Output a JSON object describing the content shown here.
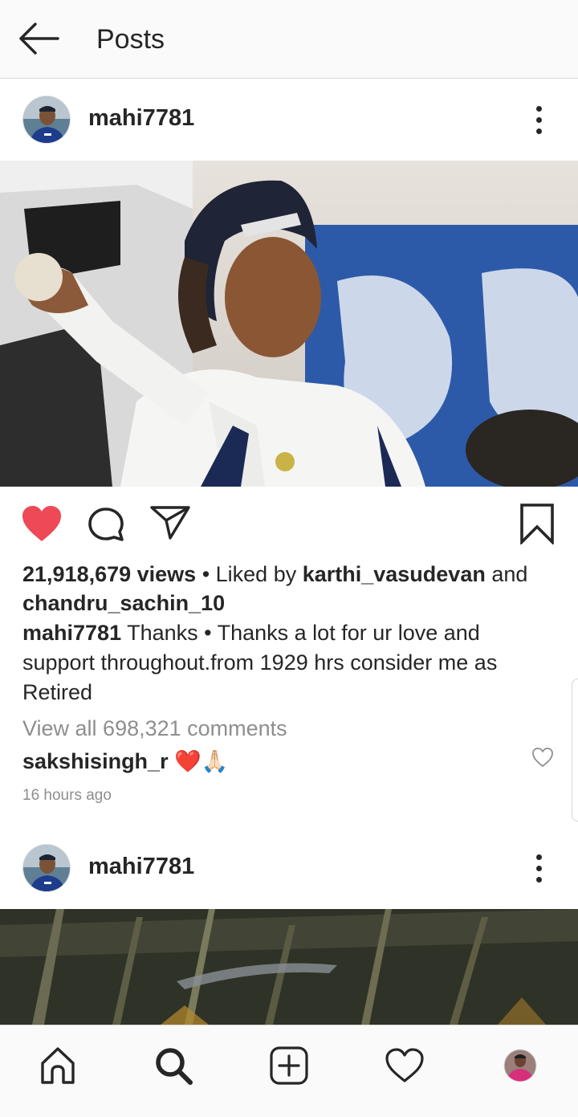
{
  "topbar": {
    "title": "Posts",
    "back_icon": "arrow-left-icon"
  },
  "post1": {
    "username": "mahi7781",
    "views": "21,918,679 views",
    "liked_by_prefix": " • Liked by ",
    "liked_by_user1": "karthi_vasudevan",
    "liked_by_and": " and",
    "liked_by_user2": "chandru_sachin_10",
    "caption_user": "mahi7781",
    "caption_text": " Thanks • Thanks a lot for ur love and support throughout.from 1929 hrs consider me as Retired",
    "view_comments": "View all 698,321 comments",
    "comment_user": "sakshisingh_r",
    "comment_emoji": "❤️🙏🏻",
    "timestamp": "16 hours ago",
    "liked": true
  },
  "post2": {
    "username": "mahi7781"
  },
  "nav": {
    "items": [
      "home-icon",
      "search-icon",
      "add-icon",
      "heart-icon",
      "profile-avatar"
    ]
  },
  "colors": {
    "like_red": "#ed4956",
    "text": "#262626",
    "muted": "#8e8e8e",
    "bar_bg": "#fafafa"
  }
}
